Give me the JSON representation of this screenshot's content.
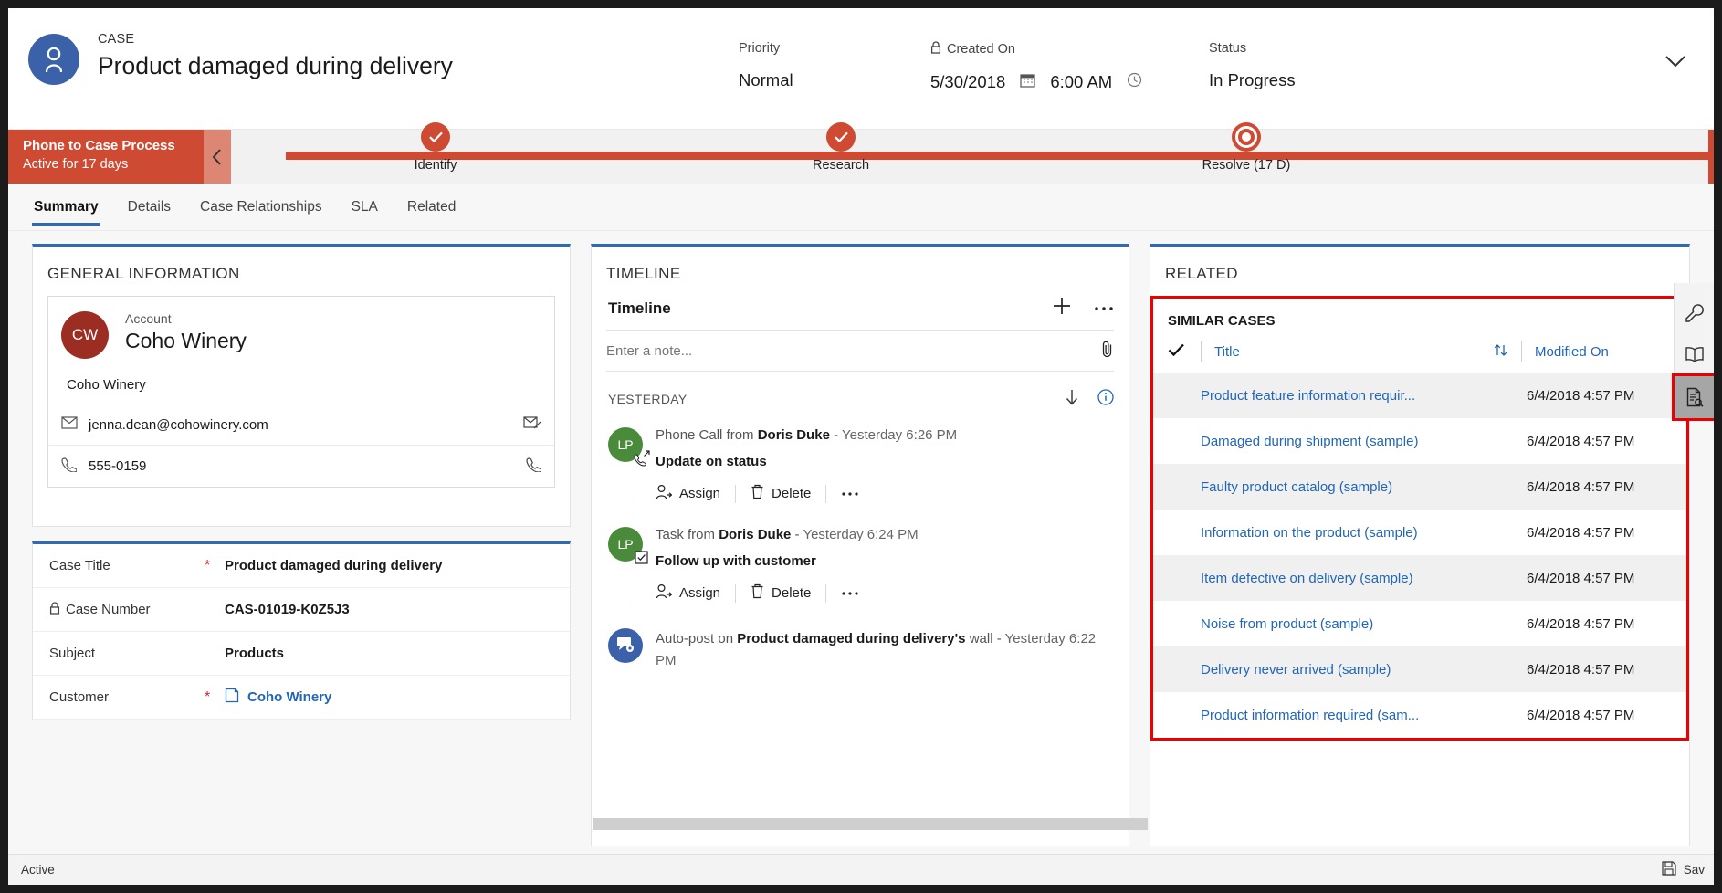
{
  "header": {
    "entity_label": "CASE",
    "record_title": "Product damaged during delivery",
    "avatar_icon": "person-icon",
    "fields": [
      {
        "label": "Priority",
        "value": "Normal",
        "locked": false
      },
      {
        "label": "Created On",
        "value": "5/30/2018",
        "value2": "6:00 AM",
        "locked": true
      },
      {
        "label": "Status",
        "value": "In Progress",
        "locked": false
      }
    ],
    "collapse_icon": "chevron-down-icon"
  },
  "process": {
    "name": "Phone to Case Process",
    "active_for": "Active for 17 days",
    "collapse_icon": "chevron-left-icon",
    "accent_color": "#ce4a32",
    "stages": [
      {
        "label": "Identify",
        "state": "complete"
      },
      {
        "label": "Research",
        "state": "complete"
      },
      {
        "label": "Resolve  (17 D)",
        "state": "current"
      }
    ]
  },
  "tabs": [
    {
      "label": "Summary",
      "active": true
    },
    {
      "label": "Details",
      "active": false
    },
    {
      "label": "Case Relationships",
      "active": false
    },
    {
      "label": "SLA",
      "active": false
    },
    {
      "label": "Related",
      "active": false
    }
  ],
  "general_information": {
    "section_title": "GENERAL INFORMATION",
    "contact": {
      "initials": "CW",
      "eyebrow": "Account",
      "name": "Coho Winery",
      "company": "Coho Winery",
      "email": "jenna.dean@cohowinery.com",
      "phone": "555-0159",
      "email_icon": "envelope-icon",
      "phone_icon": "phone-icon",
      "email_action_icon": "compose-email-icon",
      "phone_action_icon": "call-icon"
    },
    "fields": [
      {
        "label": "Case Title",
        "required": true,
        "value": "Product damaged during delivery",
        "locked": false,
        "link": false
      },
      {
        "label": "Case Number",
        "required": false,
        "value": "CAS-01019-K0Z5J3",
        "locked": true,
        "link": false
      },
      {
        "label": "Subject",
        "required": false,
        "value": "Products",
        "locked": false,
        "link": false
      },
      {
        "label": "Customer",
        "required": true,
        "value": "Coho Winery",
        "locked": false,
        "link": true,
        "link_icon": "account-lookup-icon"
      }
    ]
  },
  "timeline": {
    "section_title": "TIMELINE",
    "subtitle": "Timeline",
    "add_icon": "plus-icon",
    "more_icon": "ellipsis-icon",
    "note_placeholder": "Enter a note...",
    "attach_icon": "paperclip-icon",
    "day_separator": "YESTERDAY",
    "sort_icon": "arrow-down-icon",
    "info_icon": "info-icon",
    "entries": [
      {
        "avatar_initials": "LP",
        "avatar_color": "green",
        "badge_icon": "phone-outgoing-icon",
        "prefix": "Phone Call from ",
        "actor": "Doris Duke",
        "separator": " - ",
        "time": "Yesterday 6:26 PM",
        "subject": "Update on status",
        "actions": [
          {
            "label": "Assign",
            "icon": "assign-user-icon"
          },
          {
            "label": "Delete",
            "icon": "trash-icon"
          },
          {
            "label": "",
            "icon": "ellipsis-icon"
          }
        ]
      },
      {
        "avatar_initials": "LP",
        "avatar_color": "green",
        "badge_icon": "task-checkbox-icon",
        "prefix": "Task from ",
        "actor": "Doris Duke",
        "separator": " - ",
        "time": "Yesterday 6:24 PM",
        "subject": "Follow up with customer",
        "actions": [
          {
            "label": "Assign",
            "icon": "assign-user-icon"
          },
          {
            "label": "Delete",
            "icon": "trash-icon"
          },
          {
            "label": "",
            "icon": "ellipsis-icon"
          }
        ]
      },
      {
        "avatar_initials": "",
        "avatar_color": "blue",
        "badge_icon": "auto-post-icon",
        "prefix": "Auto-post on ",
        "actor": "Product damaged during delivery's",
        "separator": " wall - ",
        "time": "Yesterday 6:22 PM",
        "subject": "",
        "actions": []
      }
    ]
  },
  "related": {
    "section_title": "RELATED",
    "similar_cases": {
      "title": "SIMILAR CASES",
      "check_icon": "checkmark-icon",
      "sort_icon": "sort-updown-icon",
      "columns": [
        "Title",
        "Modified On"
      ],
      "rows": [
        {
          "title": "Product feature information requir...",
          "modified_on": "6/4/2018 4:57 PM"
        },
        {
          "title": "Damaged during shipment (sample)",
          "modified_on": "6/4/2018 4:57 PM"
        },
        {
          "title": "Faulty product catalog (sample)",
          "modified_on": "6/4/2018 4:57 PM"
        },
        {
          "title": "Information on the product (sample)",
          "modified_on": "6/4/2018 4:57 PM"
        },
        {
          "title": "Item defective on delivery (sample)",
          "modified_on": "6/4/2018 4:57 PM"
        },
        {
          "title": "Noise from product (sample)",
          "modified_on": "6/4/2018 4:57 PM"
        },
        {
          "title": "Delivery never arrived (sample)",
          "modified_on": "6/4/2018 4:57 PM"
        },
        {
          "title": "Product information required (sam...",
          "modified_on": "6/4/2018 4:57 PM"
        }
      ]
    },
    "highlight_color": "#ee0000"
  },
  "right_rail": [
    {
      "icon": "wrench-icon",
      "active": false
    },
    {
      "icon": "book-icon",
      "active": false
    },
    {
      "icon": "document-search-icon",
      "active": true
    }
  ],
  "footer": {
    "status": "Active",
    "save_label": "Sav",
    "save_icon": "save-icon"
  }
}
